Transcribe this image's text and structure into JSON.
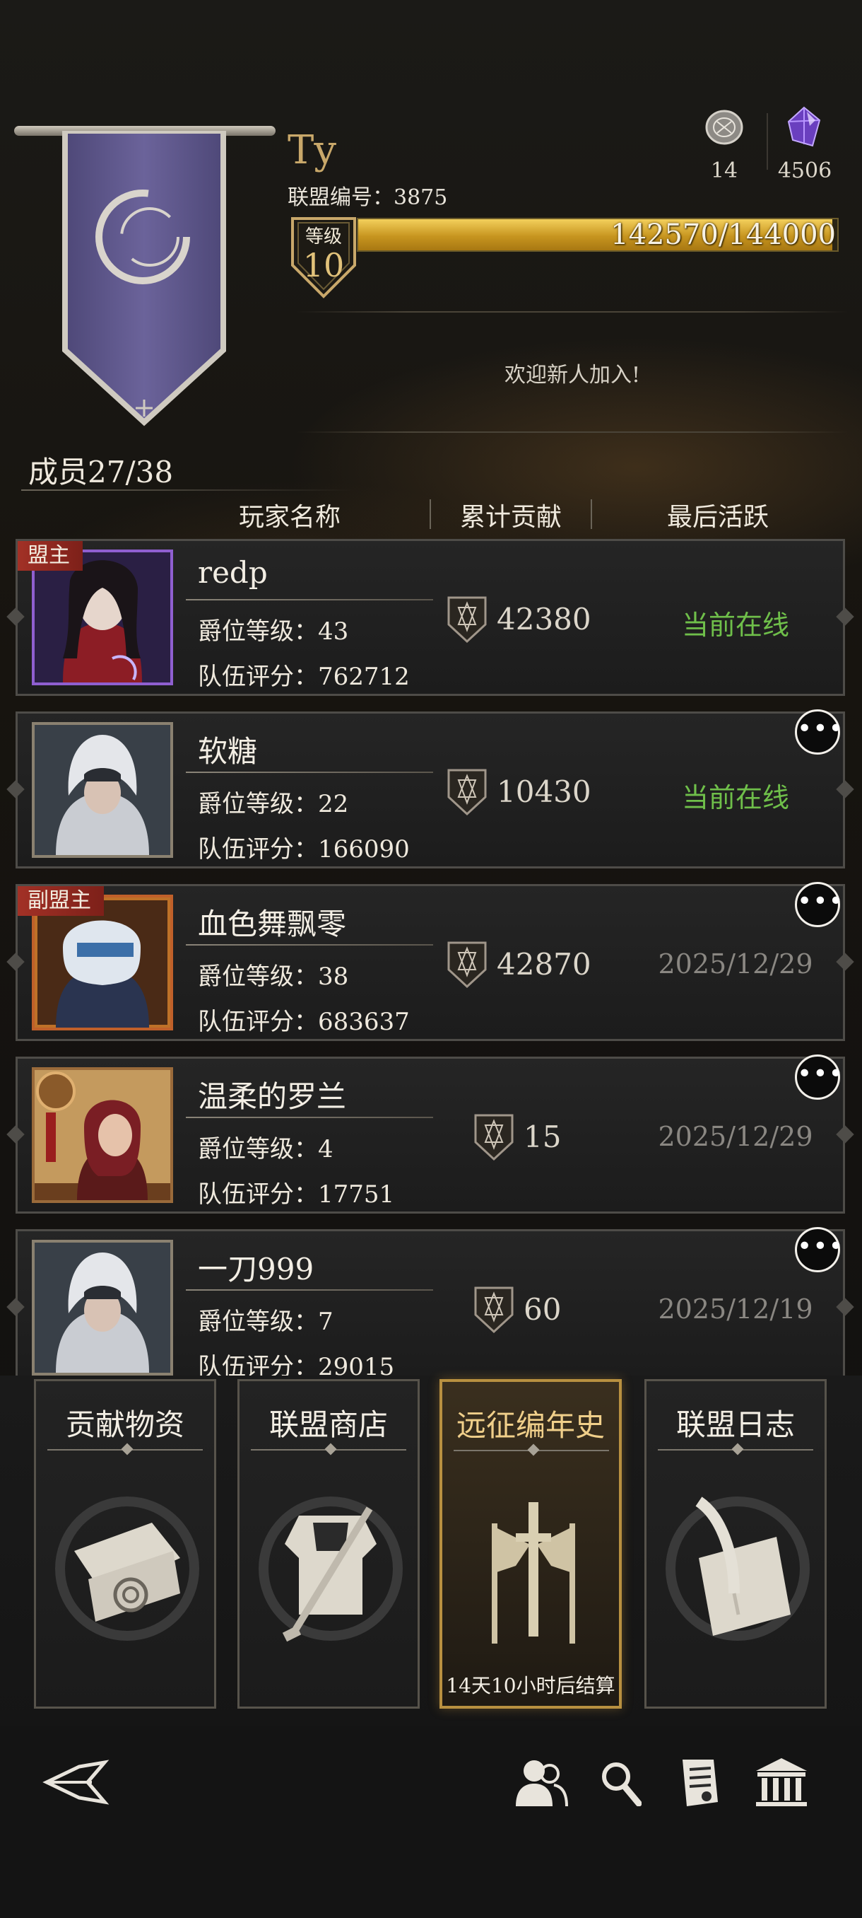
{
  "guild": {
    "name": "Ty",
    "id_text": "联盟编号：3875",
    "level_label": "等级",
    "level": "10",
    "exp_text": "142570/144000",
    "exp_fraction": 0.99,
    "notice": "欢迎新人加入!"
  },
  "resources": [
    {
      "icon": "coin-icon",
      "value": "14"
    },
    {
      "icon": "crystal-icon",
      "value": "4506"
    }
  ],
  "members_label": "成员27/38",
  "columns": {
    "name": "玩家名称",
    "contribution": "累计贡献",
    "last_active": "最后活跃"
  },
  "members": [
    {
      "role": "盟主",
      "name": "redp",
      "rank": "爵位等级：43",
      "score": "队伍评分：762712",
      "contribution": "42380",
      "last_active": "当前在线",
      "online": true,
      "more": false
    },
    {
      "role": "",
      "name": "软糖",
      "rank": "爵位等级：22",
      "score": "队伍评分：166090",
      "contribution": "10430",
      "last_active": "当前在线",
      "online": true,
      "more": true
    },
    {
      "role": "副盟主",
      "name": "血色舞飘零",
      "rank": "爵位等级：38",
      "score": "队伍评分：683637",
      "contribution": "42870",
      "last_active": "2025/12/29",
      "online": false,
      "more": true
    },
    {
      "role": "",
      "name": "温柔的罗兰",
      "rank": "爵位等级：4",
      "score": "队伍评分：17751",
      "contribution": "15",
      "last_active": "2025/12/29",
      "online": false,
      "more": true
    },
    {
      "role": "",
      "name": "一刀999",
      "rank": "爵位等级：7",
      "score": "队伍评分：29015",
      "contribution": "60",
      "last_active": "2025/12/19",
      "online": false,
      "more": true
    }
  ],
  "cards": [
    {
      "title": "贡献物资",
      "note": ""
    },
    {
      "title": "联盟商店",
      "note": ""
    },
    {
      "title": "远征编年史",
      "note": "14天10小时后结算"
    },
    {
      "title": "联盟日志",
      "note": ""
    }
  ],
  "colors": {
    "online": "#6fbf4a",
    "gold": "#c9a86a",
    "role_badge": "#a23126",
    "active_card_border": "#b89040"
  },
  "nav_icons": [
    "back-icon",
    "members-icon",
    "search-icon",
    "document-icon",
    "guild-hall-icon"
  ]
}
